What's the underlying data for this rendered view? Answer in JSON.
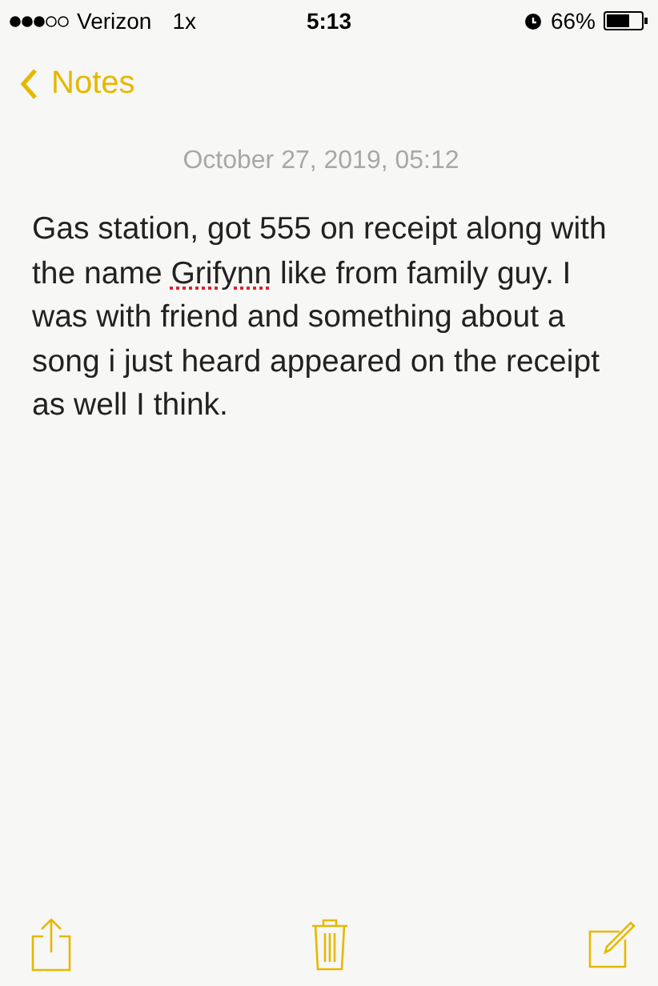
{
  "status_bar": {
    "carrier": "Verizon",
    "network": "1x",
    "time": "5:13",
    "battery_percent": "66%"
  },
  "nav": {
    "back_label": "Notes"
  },
  "note": {
    "date": "October 27, 2019, 05:12",
    "body": [
      {
        "text": "Gas station, got 555 on receipt along with the name ",
        "misspelled": false
      },
      {
        "text": "Grifynn",
        "misspelled": true
      },
      {
        "text": " like from family guy. I was with friend and something about a song i just heard appeared on the receipt as well I think.",
        "misspelled": false
      }
    ]
  }
}
